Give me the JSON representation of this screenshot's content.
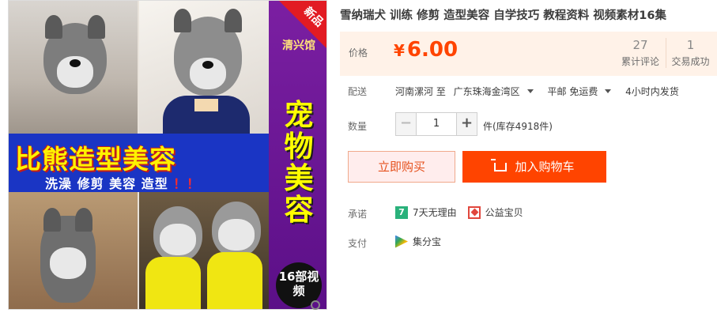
{
  "product": {
    "title": "雪纳瑞犬 训练 修剪 造型美容 自学技巧 教程资料 视频素材16集"
  },
  "gallery": {
    "banner_title": "比熊造型美容",
    "banner_sub": "洗澡 修剪 美容 造型",
    "banner_bang": "！！",
    "side_logo": "清兴馆",
    "side_vertical": "宠物美容",
    "side_badge": "16部视频",
    "new_tag": "新品"
  },
  "price": {
    "label": "价格",
    "currency": "¥",
    "value": "6.00"
  },
  "stats": {
    "reviews_count": "27",
    "reviews_label": "累计评论",
    "sales_count": "1",
    "sales_label": "交易成功"
  },
  "delivery": {
    "label": "配送",
    "from": "河南漯河 至",
    "to": "广东珠海金湾区",
    "shipping": "平邮 免运费",
    "dispatch": "4小时内发货"
  },
  "quantity": {
    "label": "数量",
    "value": "1",
    "minus": "−",
    "plus": "+",
    "stock": "件(库存4918件)"
  },
  "actions": {
    "buy_now": "立即购买",
    "add_to_cart": "加入购物车"
  },
  "promise": {
    "label": "承诺",
    "badge": "7",
    "return_policy": "7天无理由",
    "charity": "公益宝贝"
  },
  "payment": {
    "label": "支付",
    "method": "集分宝"
  },
  "colors": {
    "accent": "#ff4400",
    "price_bg": "#fff2e8"
  }
}
